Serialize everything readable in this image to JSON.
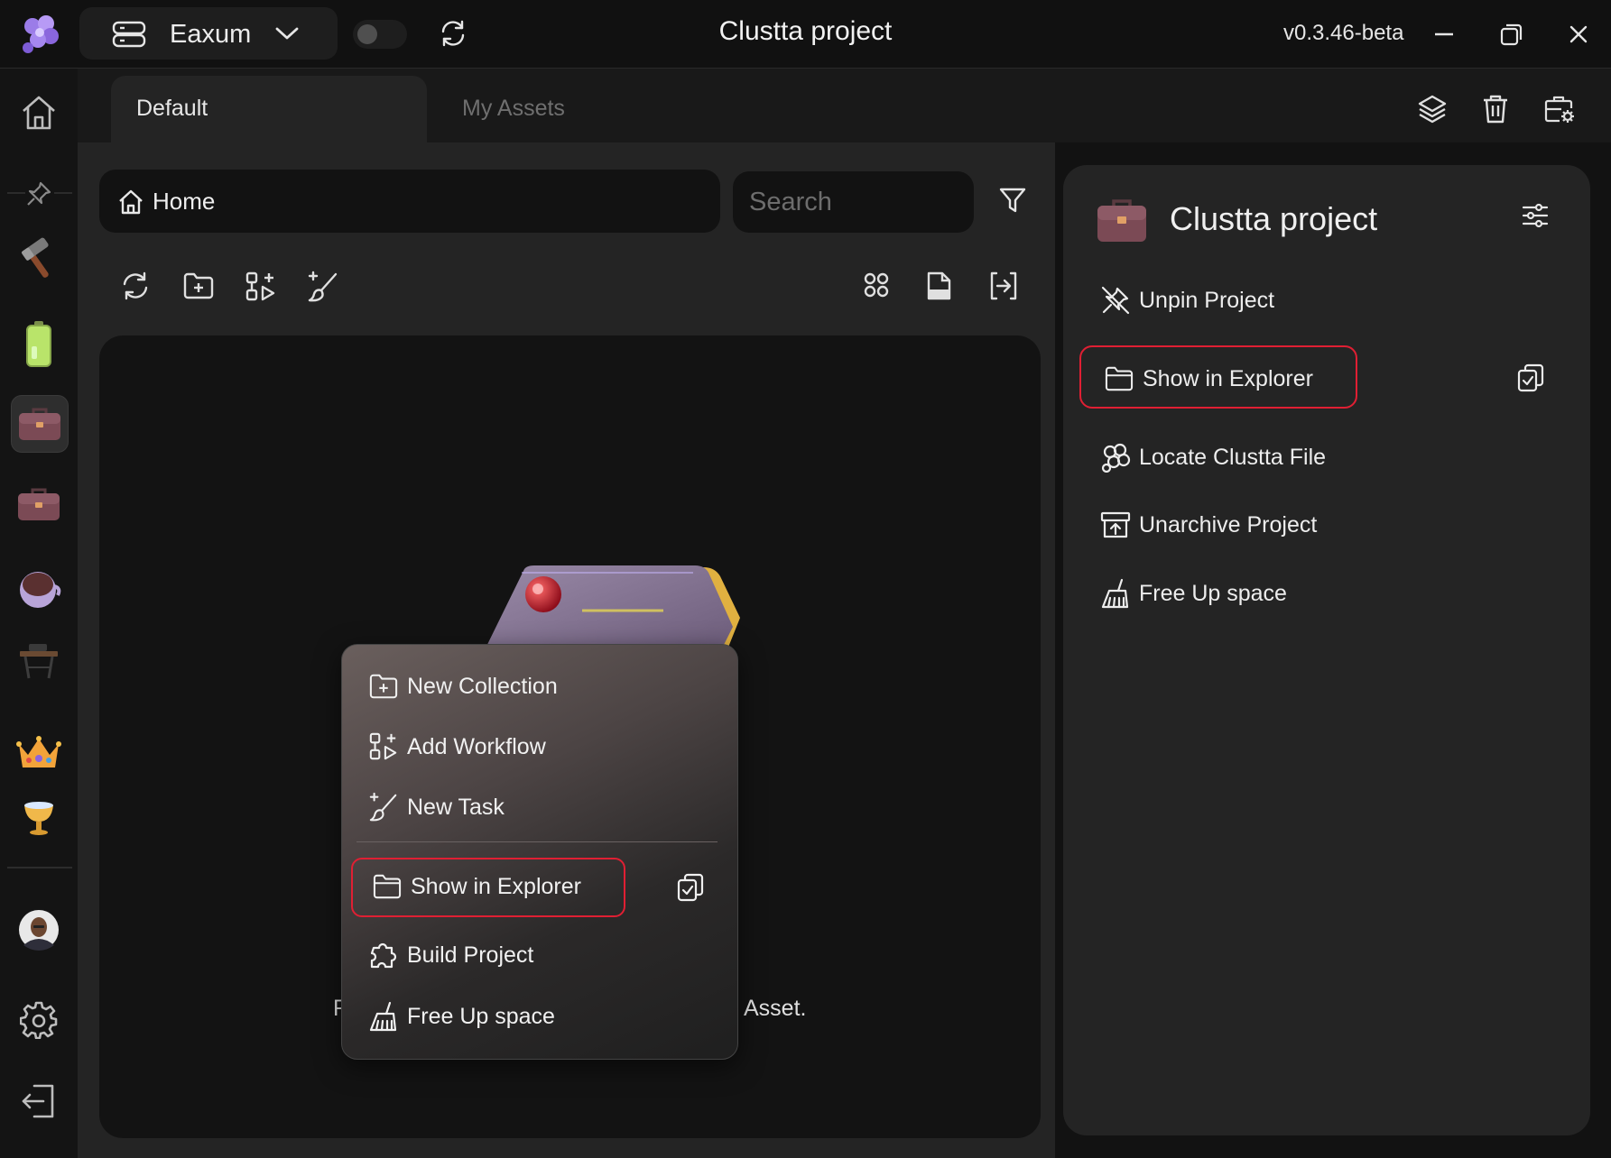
{
  "titlebar": {
    "workspace": "Eaxum",
    "title": "Clustta project",
    "version": "v0.3.46-beta"
  },
  "tabs": [
    {
      "label": "Default"
    },
    {
      "label": "My Assets"
    }
  ],
  "path": {
    "label": "Home"
  },
  "search": {
    "placeholder": "Search"
  },
  "empty_hint": {
    "before": "F",
    "after": "Asset."
  },
  "context_menu": {
    "items": [
      {
        "label": "New Collection"
      },
      {
        "label": "Add Workflow"
      },
      {
        "label": "New Task"
      },
      {
        "label": "Show in Explorer"
      },
      {
        "label": "Build Project"
      },
      {
        "label": "Free Up space"
      }
    ]
  },
  "right_panel": {
    "title": "Clustta project",
    "items": [
      {
        "label": "Unpin Project"
      },
      {
        "label": "Show in Explorer"
      },
      {
        "label": "Locate Clustta File"
      },
      {
        "label": "Unarchive Project"
      },
      {
        "label": "Free Up space"
      }
    ]
  },
  "colors": {
    "highlight": "#e01f33",
    "background": "#121212",
    "panel": "#242424"
  }
}
